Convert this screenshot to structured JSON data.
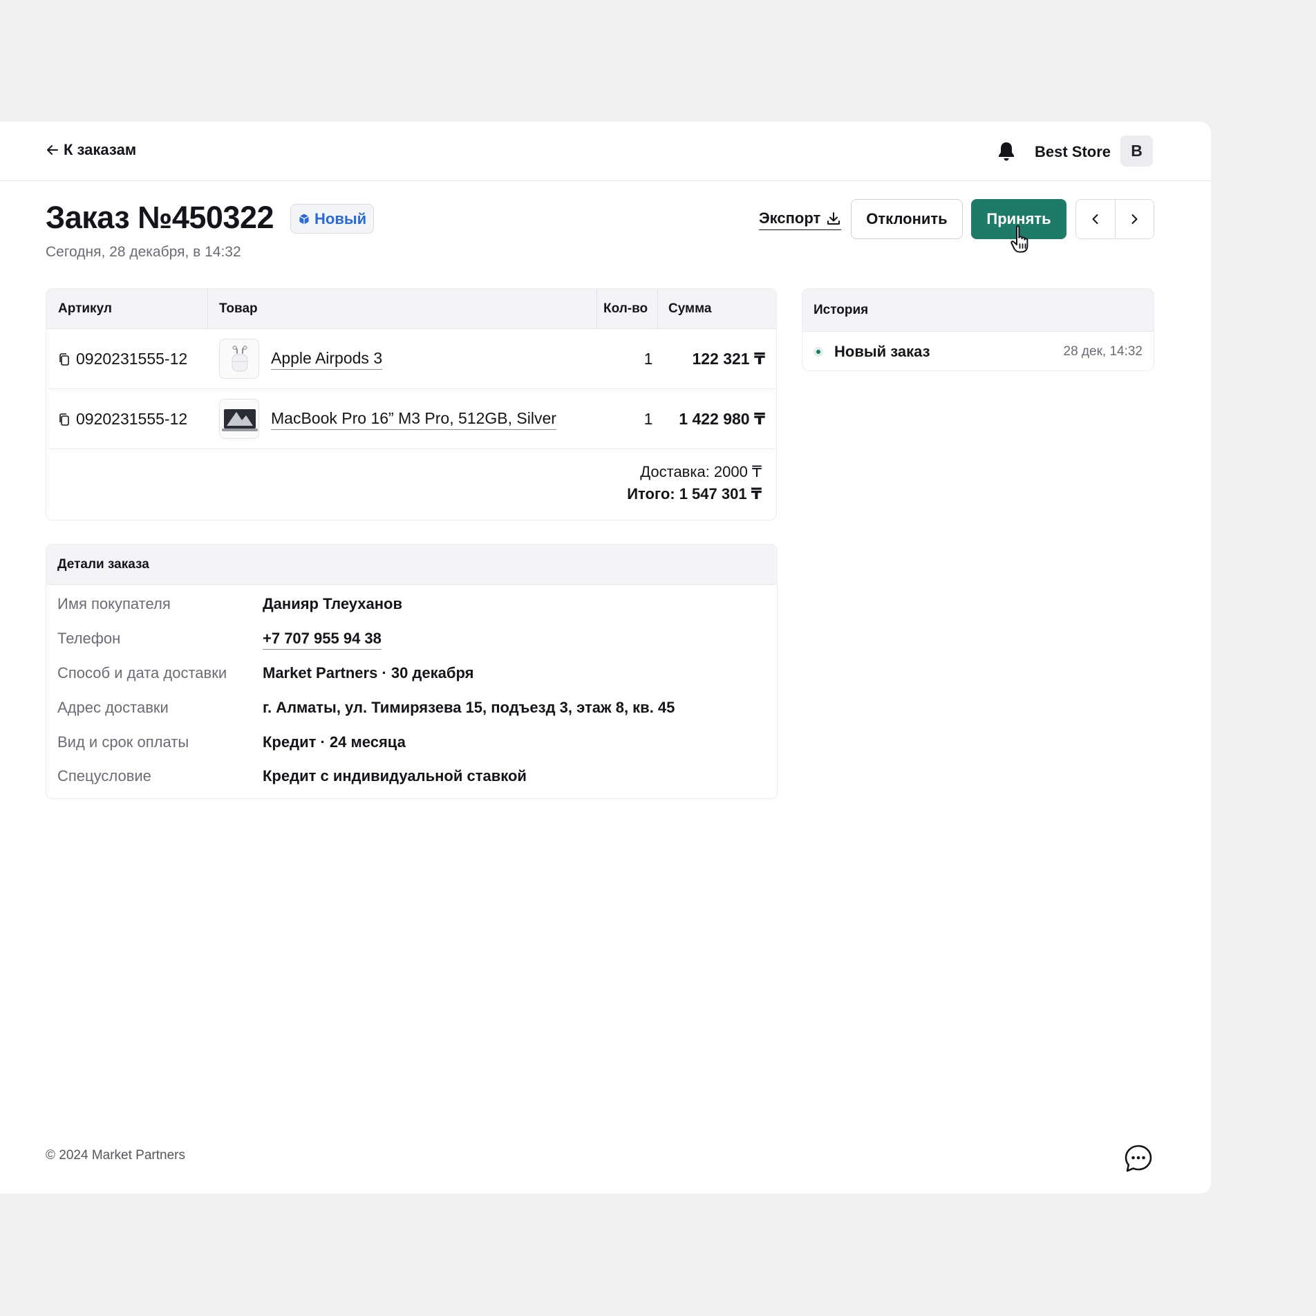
{
  "topbar": {
    "back_label": "К заказам",
    "store_name": "Best Store",
    "avatar_letter": "B"
  },
  "order": {
    "title": "Заказ №450322",
    "status": "Новый",
    "date": "Сегодня, 28 декабря, в 14:32"
  },
  "actions": {
    "export_label": "Экспорт",
    "decline_label": "Отклонить",
    "accept_label": "Принять",
    "accent_color": "#1e7b68"
  },
  "items_table": {
    "headers": {
      "sku": "Артикул",
      "product": "Товар",
      "qty": "Кол-во",
      "sum": "Сумма"
    },
    "rows": [
      {
        "sku": "0920231555-12",
        "product": "Apple Airpods 3",
        "qty": "1",
        "sum": "122 321 ₸"
      },
      {
        "sku": "0920231555-12",
        "product": "MacBook Pro 16” M3 Pro, 512GB, Silver",
        "qty": "1",
        "sum": "1 422 980 ₸"
      }
    ],
    "delivery": "Доставка: 2000 ₸",
    "total": "Итого: 1 547 301 ₸"
  },
  "history": {
    "title": "История",
    "events": [
      {
        "label": "Новый заказ",
        "date": "28 дек, 14:32"
      }
    ]
  },
  "details": {
    "title": "Детали заказа",
    "rows": [
      {
        "label": "Имя покупателя",
        "value": "Данияр Тлеуханов"
      },
      {
        "label": "Телефон",
        "value": "+7 707 955 94 38"
      },
      {
        "label": "Способ и дата доставки",
        "value": "Market Partners · 30 декабря"
      },
      {
        "label": "Адрес доставки",
        "value": "г. Алматы, ул. Тимирязева 15, подъезд 3, этаж 8, кв. 45"
      },
      {
        "label": "Вид и срок оплаты",
        "value": "Кредит · 24 месяца"
      },
      {
        "label": "Спецусловие",
        "value": "Кредит с индивидуальной ставкой"
      }
    ]
  },
  "footer": {
    "copyright": "© 2024 Market Partners"
  },
  "icons": [
    "arrow-left-icon",
    "bell-icon",
    "box-icon",
    "download-icon",
    "chevron-left-icon",
    "chevron-right-icon",
    "copy-icon",
    "chat-icon",
    "hand-cursor-icon"
  ]
}
